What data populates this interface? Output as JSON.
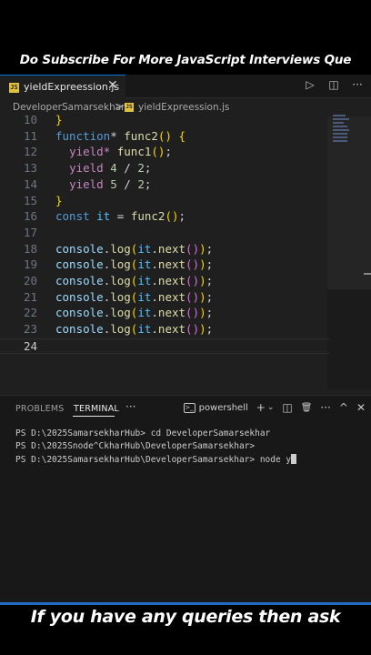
{
  "top_banner": "Do Subscribe For More JavaScript Interviews Que",
  "tab": {
    "file_name": "yieldExpreession.js",
    "close": "✕",
    "icon": "js-file-icon"
  },
  "tab_actions": {
    "run": "▷",
    "split": "◫",
    "more": "···"
  },
  "breadcrumb": {
    "folder": "DeveloperSamarsekhar",
    "separator": ">",
    "file": "yieldExpreession.js"
  },
  "code_lines": [
    {
      "n": "10",
      "t": "}"
    },
    {
      "n": "11",
      "t": "function* func2() {"
    },
    {
      "n": "12",
      "t": "  yield* func1();"
    },
    {
      "n": "13",
      "t": "  yield 4 / 2;"
    },
    {
      "n": "14",
      "t": "  yield 5 / 2;"
    },
    {
      "n": "15",
      "t": "}"
    },
    {
      "n": "16",
      "t": "const it = func2();"
    },
    {
      "n": "17",
      "t": ""
    },
    {
      "n": "18",
      "t": "console.log(it.next());"
    },
    {
      "n": "19",
      "t": "console.log(it.next());"
    },
    {
      "n": "20",
      "t": "console.log(it.next());"
    },
    {
      "n": "21",
      "t": "console.log(it.next());"
    },
    {
      "n": "22",
      "t": "console.log(it.next());"
    },
    {
      "n": "23",
      "t": "console.log(it.next());"
    },
    {
      "n": "24",
      "t": ""
    }
  ],
  "panel": {
    "tabs": [
      "PROBLEMS",
      "TERMINAL"
    ],
    "active_tab": "TERMINAL",
    "more": "···",
    "shell": "powershell",
    "actions": {
      "add": "+",
      "dropdown": "⌄",
      "split": "◫",
      "trash": "🗑",
      "ellipsis": "···",
      "maximize": "^",
      "close": "✕"
    }
  },
  "terminal_lines": [
    "PS D:\\2025SamarsekharHub> cd DeveloperSamarsekhar",
    "PS D:\\2025Snode^CkharHub\\DeveloperSamarsekhar>",
    "PS D:\\2025SamarsekharHub\\DeveloperSamarsekhar> node y"
  ],
  "bottom_banner": "If you have any queries then ask",
  "colors": {
    "accent": "#0078d4",
    "editor_bg": "#1f1f1f",
    "panel_bg": "#181818",
    "js_badge": "#e0c23c"
  }
}
